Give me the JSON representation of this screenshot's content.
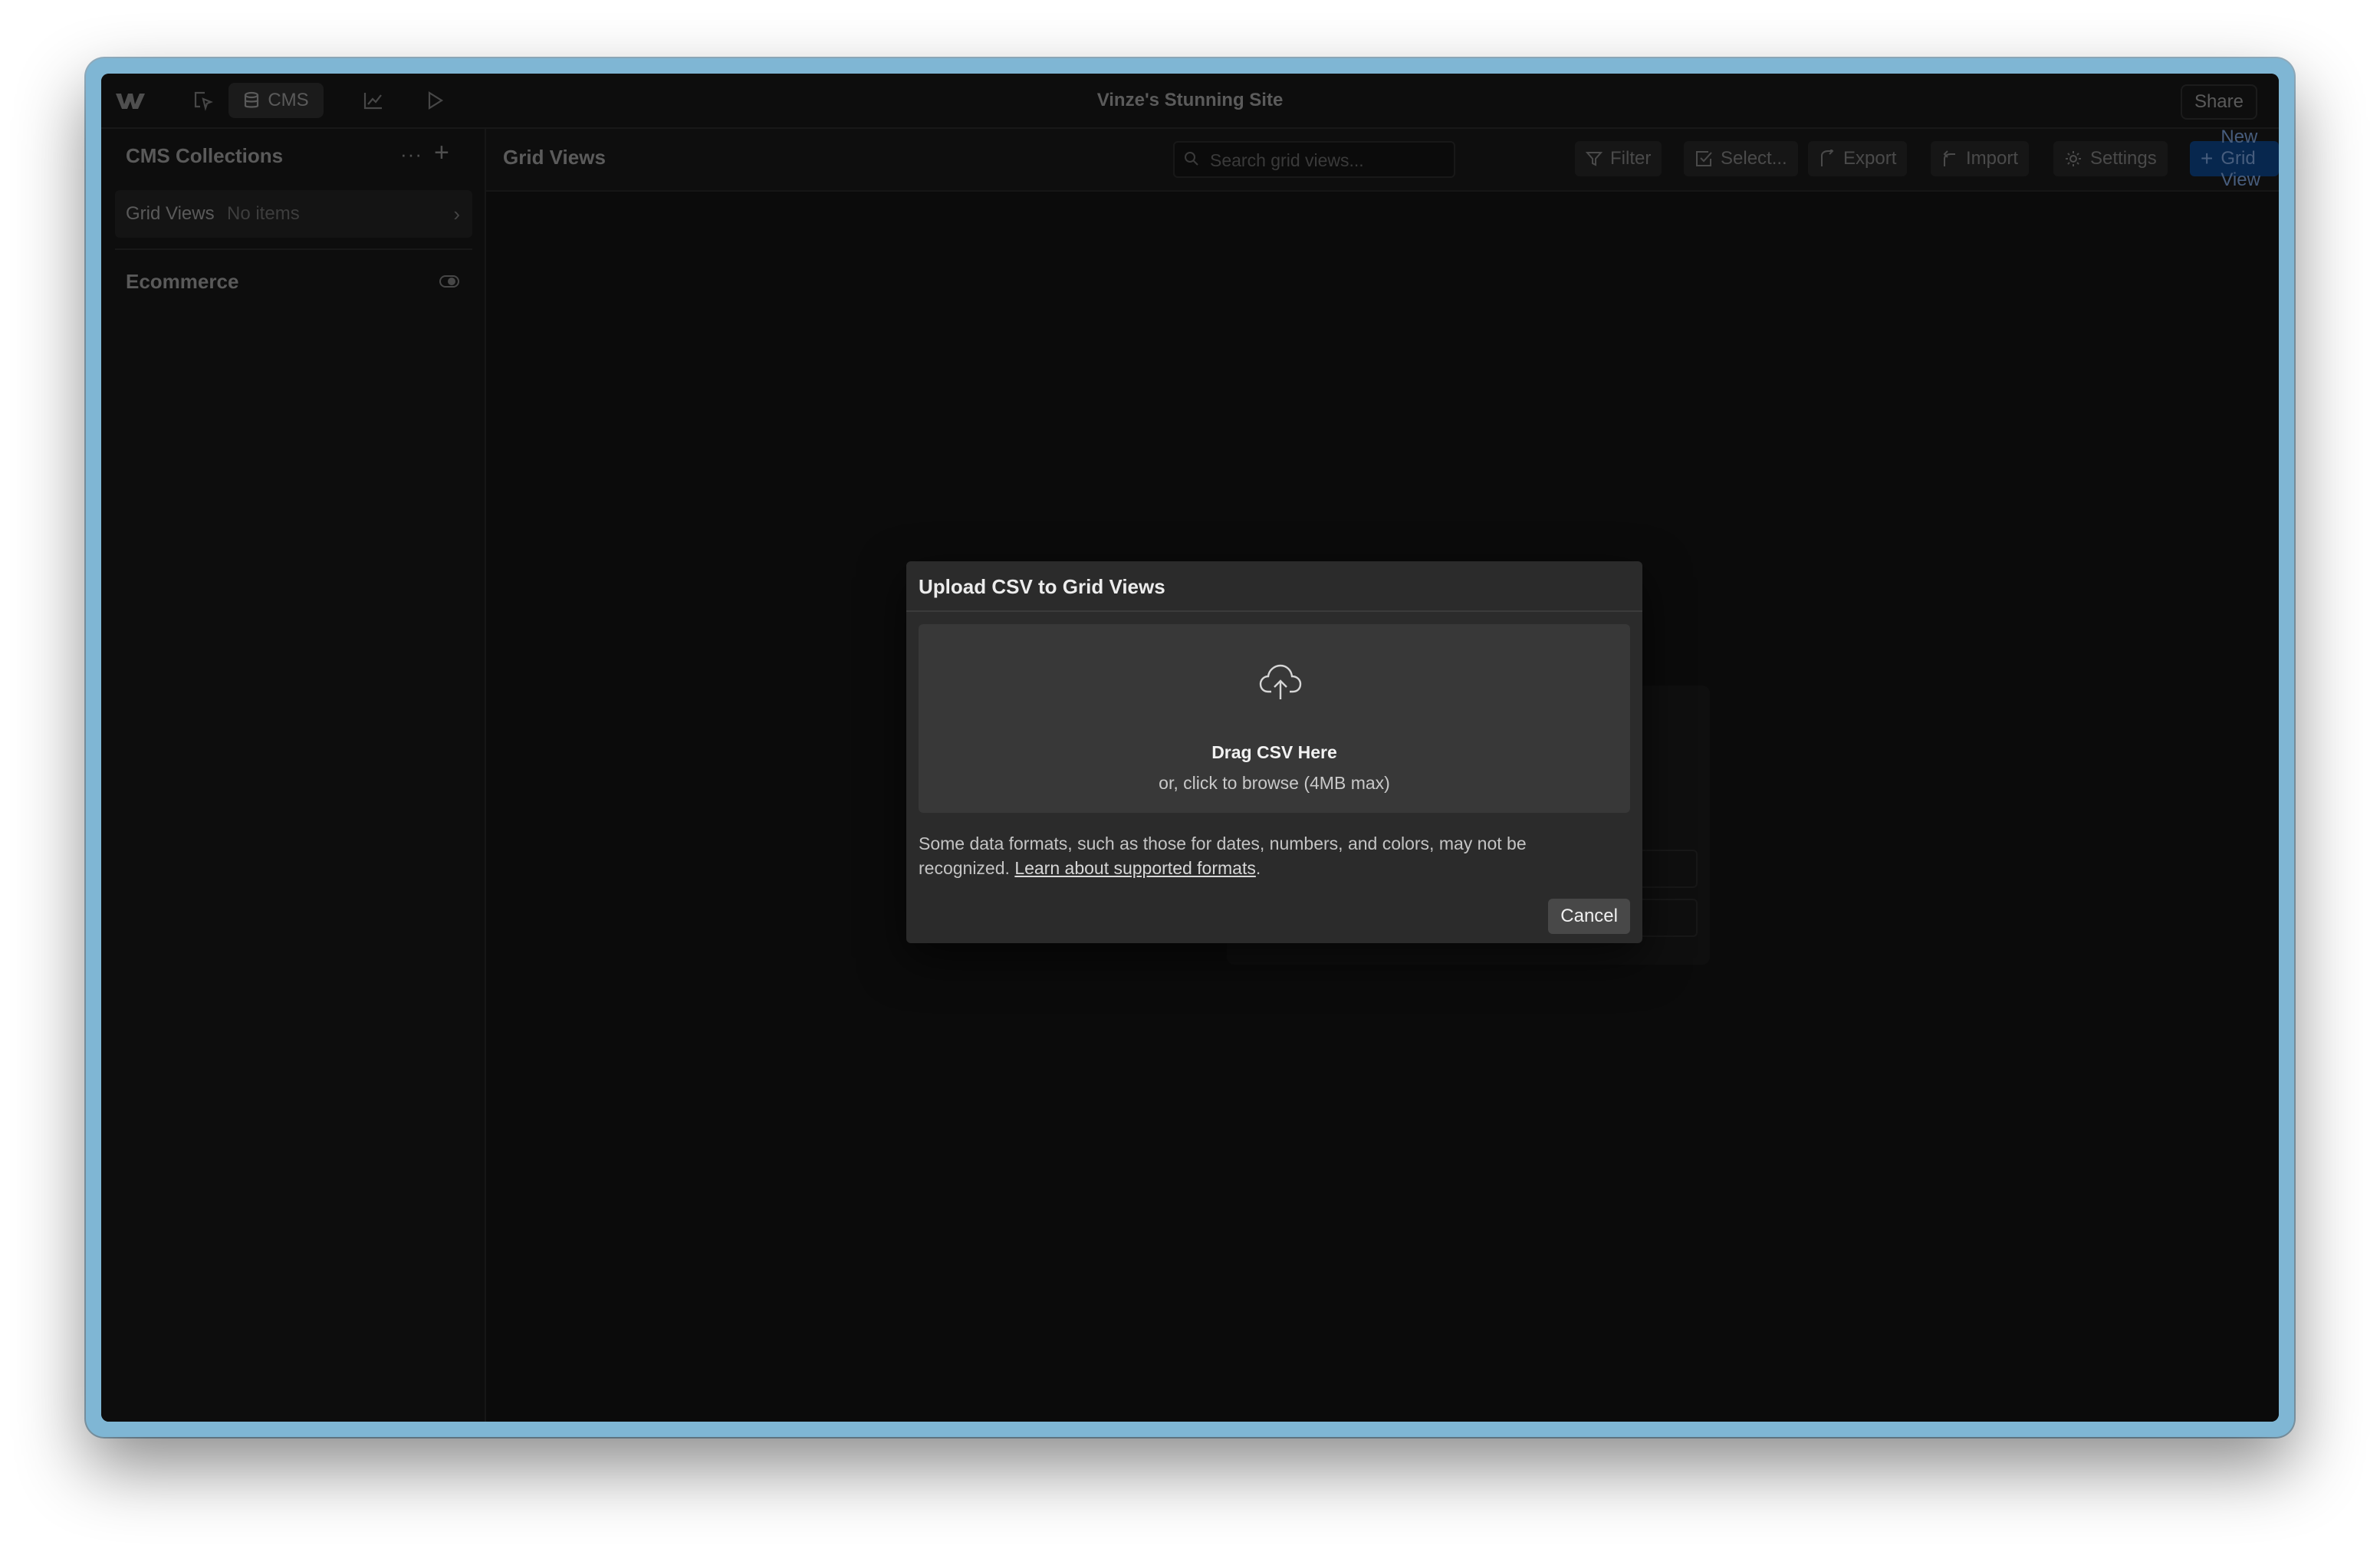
{
  "topbar": {
    "logo_icon": "webflow-logo",
    "nav_icons": [
      "cursor-select-icon",
      "database-icon",
      "chart-icon",
      "play-icon"
    ],
    "cms_label": "CMS",
    "site_title": "Vinze's Stunning Site",
    "share_label": "Share"
  },
  "sidebar": {
    "header": "CMS Collections",
    "more_label": "···",
    "add_label": "+",
    "collection": {
      "name": "Grid Views",
      "meta": "No items",
      "chevron": "›"
    },
    "ecommerce_label": "Ecommerce"
  },
  "main": {
    "title": "Grid Views",
    "search_placeholder": "Search grid views...",
    "buttons": {
      "filter": "Filter",
      "select": "Select...",
      "export": "Export",
      "import": "Import",
      "settings": "Settings",
      "new": "New Grid View"
    }
  },
  "modal": {
    "title": "Upload CSV to Grid Views",
    "drop_title": "Drag CSV Here",
    "drop_sub": "or, click to browse (4MB max)",
    "note_text": "Some data formats, such as those for dates, numbers, and colors, may not be recognized. ",
    "note_link": "Learn about supported formats",
    "note_end": ".",
    "cancel_label": "Cancel"
  },
  "colors": {
    "frame": "#7fb6d4",
    "app_bg": "#111111",
    "primary_button": "#0b3c78",
    "modal_bg": "#2b2b2b"
  }
}
